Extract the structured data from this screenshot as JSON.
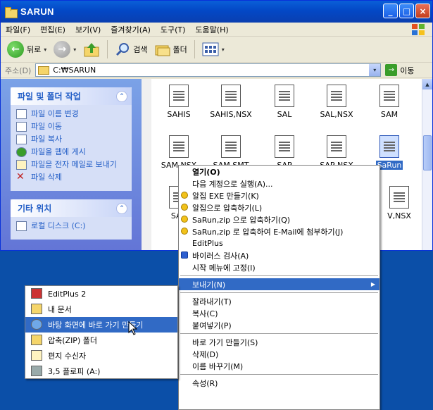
{
  "window": {
    "title": "SARUN",
    "buttons": {
      "minimize": "_",
      "maximize": "□",
      "close": "×"
    }
  },
  "menubar": [
    "파일(F)",
    "편집(E)",
    "보기(V)",
    "즐겨찾기(A)",
    "도구(T)",
    "도움말(H)"
  ],
  "toolbar": {
    "back": "뒤로",
    "search": "검색",
    "folders": "폴더",
    "dropdown_arrow": "▾"
  },
  "address": {
    "label": "주소(D)",
    "value": "C:₩SARUN",
    "go": "이동",
    "go_arrow": "→",
    "dropdown_arrow": "▾"
  },
  "sidebar": {
    "collapse_glyph": "⌃",
    "file_tasks": {
      "title": "파일 및 폴더 작업",
      "items": [
        "파일 이름 변경",
        "파일 이동",
        "파일 복사",
        "파일을 웹에 게시",
        "파일을 전자 메일로 보내기",
        "파일 삭제"
      ],
      "delete_glyph": "✕"
    },
    "other_places": {
      "title": "기타 위치",
      "items": [
        "로컬 디스크 (C:)"
      ]
    }
  },
  "files": {
    "row1": [
      "SAHIS",
      "SAHIS,NSX",
      "SAL",
      "SAL,NSX",
      "SAM"
    ],
    "row2": [
      "SAM,NSX",
      "SAM,SMT",
      "SAP",
      "SAP,NSX",
      "SaRun"
    ],
    "row3": [
      "SAR",
      "V,NSX"
    ],
    "selected": "SaRun"
  },
  "context_menu": {
    "items": [
      {
        "label": "열기(O)",
        "bold": true
      },
      {
        "label": "다음 계정으로 실행(A)..."
      },
      {
        "label": "알집 EXE 만들기(K)",
        "icon": "alzip-icon"
      },
      {
        "label": "알집으로 압축하기(L)",
        "icon": "alzip-icon"
      },
      {
        "label": "SaRun,zip 으로 압축하기(Q)",
        "icon": "alzip-icon"
      },
      {
        "label": "SaRun,zip 로 압축하여 E-Mail에 첨부하기(J)",
        "icon": "alzip-icon"
      },
      {
        "label": "EditPlus"
      },
      {
        "label": "바이러스 검사(A)",
        "icon": "antivirus-icon"
      },
      {
        "label": "시작 메뉴에 고정(I)"
      },
      {
        "separator": true
      },
      {
        "label": "보내기(N)",
        "highlight": true,
        "submenu": true
      },
      {
        "separator": true
      },
      {
        "label": "잘라내기(T)"
      },
      {
        "label": "복사(C)"
      },
      {
        "label": "붙여넣기(P)"
      },
      {
        "separator": true
      },
      {
        "label": "바로 가기 만들기(S)"
      },
      {
        "label": "삭제(D)"
      },
      {
        "label": "이름 바꾸기(M)"
      },
      {
        "separator": true
      },
      {
        "label": "속성(R)"
      }
    ],
    "submenu_arrow": "▶"
  },
  "sendto_menu": {
    "items": [
      {
        "label": "EditPlus 2",
        "icon": "editplus-icon"
      },
      {
        "label": "내 문서",
        "icon": "my-documents-icon"
      },
      {
        "label": "바탕 화면에 바로 가기 만들기",
        "icon": "desktop-icon",
        "highlight": true
      },
      {
        "label": "압축(ZIP) 폴더",
        "icon": "zip-folder-icon"
      },
      {
        "label": "편지 수신자",
        "icon": "mail-recipient-icon"
      },
      {
        "label": "3,5 플로피 (A:)",
        "icon": "floppy-icon"
      }
    ]
  },
  "colors": {
    "titlebar": "#0348c6",
    "highlight": "#316ac5",
    "sidebar": "#7ba2e7",
    "desktop": "#0b4fa8"
  }
}
